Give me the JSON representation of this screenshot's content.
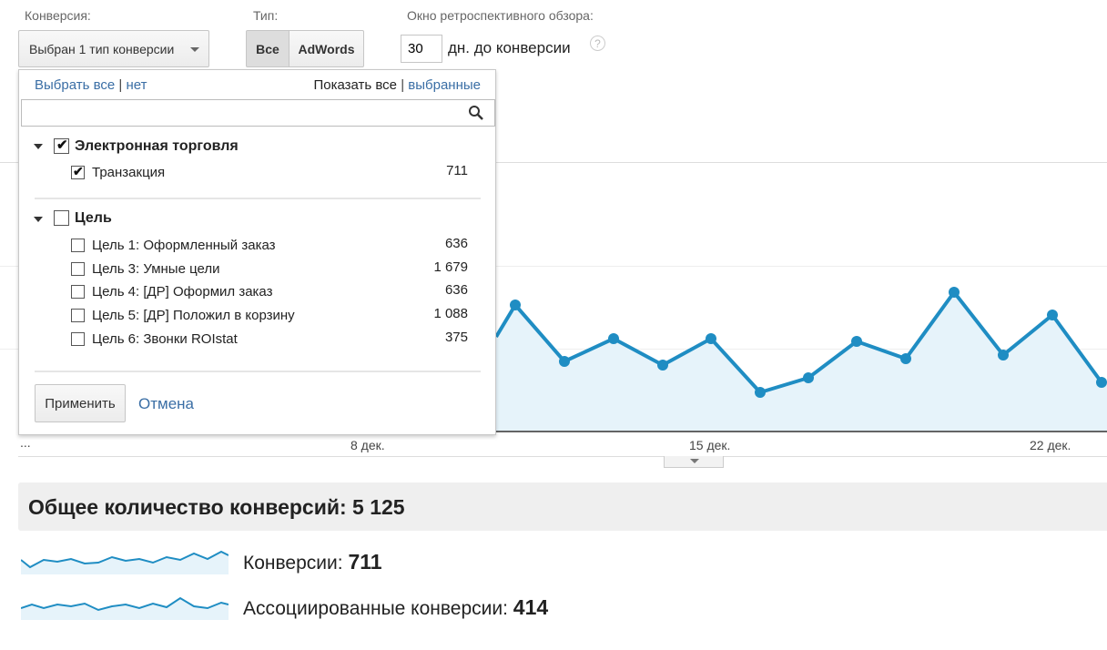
{
  "header": {
    "conversion_label": "Конверсия:",
    "conversion_dropdown": "Выбран 1 тип конверсии",
    "type_label": "Тип:",
    "type_all": "Все",
    "type_adwords": "AdWords",
    "lookback_label": "Окно ретроспективного обзора:",
    "lookback_value": "30",
    "lookback_suffix": "дн. до конверсии",
    "help_icon": "question-mark"
  },
  "dropdown": {
    "select_all": "Выбрать все",
    "separator": "|",
    "select_none": "нет",
    "show_all": "Показать все",
    "show_selected": "выбранные",
    "search_placeholder": "",
    "groups": [
      {
        "name": "Электронная торговля",
        "checked": true,
        "items": [
          {
            "label": "Транзакция",
            "count": "711",
            "checked": true
          }
        ]
      },
      {
        "name": "Цель",
        "checked": false,
        "items": [
          {
            "label": "Цель 1: Оформленный заказ",
            "count": "636",
            "checked": false
          },
          {
            "label": "Цель 3: Умные цели",
            "count": "1 679",
            "checked": false
          },
          {
            "label": "Цель 4: [ДР] Оформил заказ",
            "count": "636",
            "checked": false
          },
          {
            "label": "Цель 5: [ДР] Положил в корзину",
            "count": "1 088",
            "checked": false
          },
          {
            "label": "Цель 6: Звонки ROIstat",
            "count": "375",
            "checked": false
          }
        ]
      }
    ],
    "apply_button": "Применить",
    "cancel_button": "Отмена"
  },
  "chart": {
    "x_labels": [
      "...",
      "8 дек.",
      "15 дек.",
      "22 дек."
    ],
    "line_color": "#1f8dc3",
    "fill_color": "#e6f3fa"
  },
  "summary": {
    "title": "Общее количество конверсий: 5 125",
    "metrics": [
      {
        "label": "Конверсии:",
        "value": "711"
      },
      {
        "label": "Ассоциированные конверсии:",
        "value": "414"
      }
    ]
  }
}
